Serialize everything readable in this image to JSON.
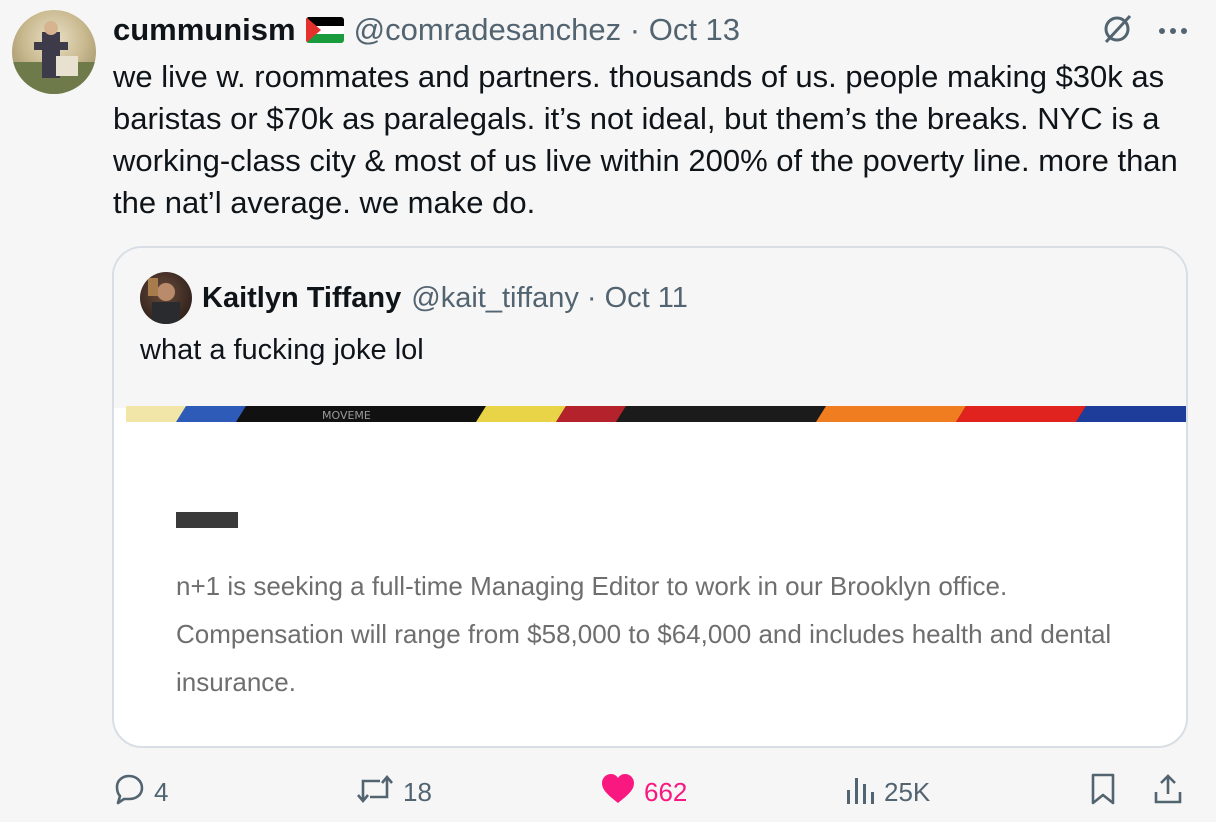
{
  "tweet": {
    "display_name": "cummunism",
    "handle_date": "@comradesanchez · Oct 13",
    "text": "we live w. roommates and partners. thousands of us. people making $30k as baristas or $70k as paralegals. it’s not ideal, but them’s the breaks. NYC is a working-class city & most of us live within 200% of the poverty line. more than the nat’l average. we make do."
  },
  "quoted": {
    "display_name": "Kaitlyn Tiffany",
    "handle_date": "@kait_tiffany · Oct 11",
    "text": "what a fucking joke lol",
    "media_text": "n+1 is seeking a full-time Managing Editor to work in our Brooklyn office. Compensation will range from $58,000 to $64,000 and includes health and dental insurance.",
    "media_strip_text": "MOVEME"
  },
  "actions": {
    "replies": "4",
    "reposts": "18",
    "likes": "662",
    "views": "25K"
  },
  "colors": {
    "like": "#f91880",
    "muted": "#536471",
    "text": "#0f1419"
  },
  "icons": [
    "grok-icon",
    "more-icon",
    "reply-icon",
    "repost-icon",
    "like-icon",
    "views-icon",
    "bookmark-icon",
    "share-icon"
  ]
}
